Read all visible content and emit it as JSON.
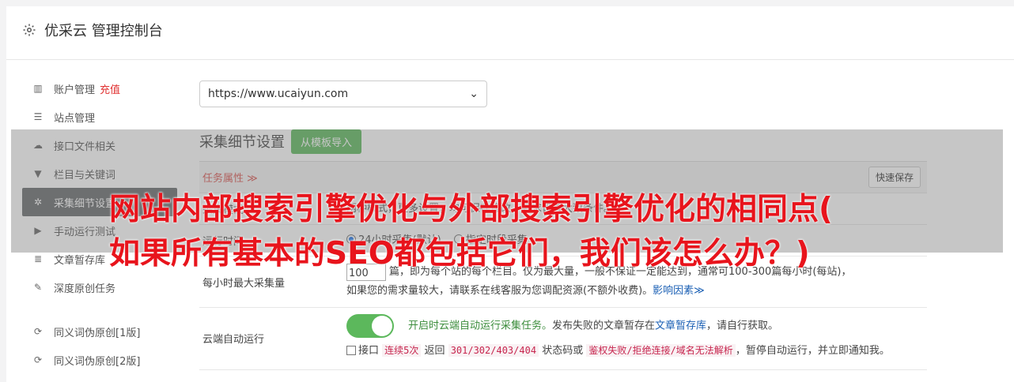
{
  "header": {
    "title": "优采云 管理控制台"
  },
  "sidebar": {
    "items": [
      {
        "label": "账户管理",
        "badge": "充值",
        "icon": "bar-chart-icon"
      },
      {
        "label": "站点管理",
        "icon": "server-icon"
      },
      {
        "label": "接口文件相关",
        "icon": "cloud-upload-icon"
      },
      {
        "label": "栏目与关键词",
        "icon": "filter-icon"
      },
      {
        "label": "采集细节设置",
        "icon": "gears-icon"
      },
      {
        "label": "手动运行测试",
        "icon": "play-icon"
      },
      {
        "label": "文章暂存库",
        "icon": "database-icon"
      },
      {
        "label": "深度原创任务",
        "icon": "edit-icon"
      },
      {
        "label": "同义词伪原创[1版]",
        "icon": "refresh-icon"
      },
      {
        "label": "同义词伪原创[2版]",
        "icon": "refresh-icon"
      }
    ]
  },
  "main": {
    "site_select": "https://www.ucaiyun.com",
    "section_title": "采集细节设置",
    "import_button": "从模板导入",
    "attr_label": "任务属性 ≫",
    "quick_save": "快速保存",
    "row1": {
      "label": "采集模式",
      "text": "两种模式，更多设置，均可保存修改，要求设置大致条件。"
    },
    "run_time": {
      "label": "运行时间",
      "opt1": "24小时采集(默认)",
      "opt2": "指定时段采集"
    },
    "max_collect": {
      "label": "每小时最大采集量",
      "value": "100",
      "line1": "篇，即为每个站的每个栏目。仅为最大量，一般不保证一定能达到，通常可100-300篇每小时(每站)，",
      "line2": "如果您的需求量较大，请联系在线客服为您调配资源(不额外收费)。",
      "line2_link": "影响因素≫"
    },
    "cloud_run": {
      "label": "云端自动运行",
      "line1_green": "开启时云端自动运行采集任务。",
      "line1_rest": "发布失败的文章暂存在",
      "line1_link": "文章暂存库",
      "line1_end": "，请自行获取。",
      "line2_a": "接口",
      "line2_code1": "连续5次",
      "line2_b": "返回",
      "line2_code2": "301/302/403/404",
      "line2_c": "状态码或",
      "line2_code3": "鉴权失败/拒绝连接/域名无法解析",
      "line2_d": "，暂停自动运行，并立即通知我。"
    }
  },
  "overlay": {
    "line1": "网站内部搜索引擎优化与外部搜索引擎优化的相同点(",
    "line2": "如果所有基本的SEO都包括它们，我们该怎么办？)"
  }
}
